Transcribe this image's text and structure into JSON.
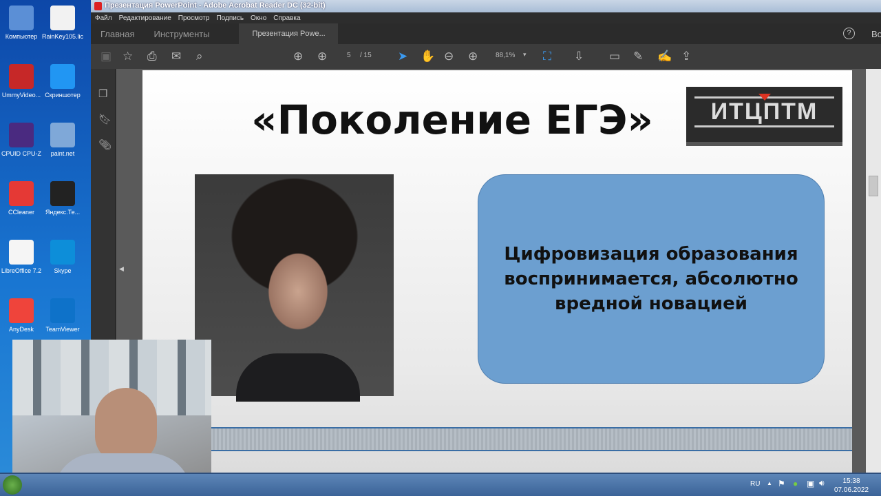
{
  "desktop": {
    "icons": [
      {
        "label": "Компьютер",
        "color": "#5b8fd6"
      },
      {
        "label": "RainKey105.lic",
        "color": "#f2f2f2"
      },
      {
        "label": "UmmyVideo...",
        "color": "#c62828"
      },
      {
        "label": "Скриншотер",
        "color": "#2196f3"
      },
      {
        "label": "CPUID CPU-Z",
        "color": "#4a2a80"
      },
      {
        "label": "paint.net",
        "color": "#7fa8d8"
      },
      {
        "label": "CCleaner",
        "color": "#e53935"
      },
      {
        "label": "Яндекс.Те...",
        "color": "#222222"
      },
      {
        "label": "LibreOffice 7.2",
        "color": "#f5f5f5"
      },
      {
        "label": "Skype",
        "color": "#0d8ed9"
      },
      {
        "label": "AnyDesk",
        "color": "#ef443b"
      },
      {
        "label": "TeamViewer",
        "color": "#0e72c9"
      }
    ]
  },
  "window": {
    "title": "Презентация PowerPoint - Adobe Acrobat Reader DC (32-bit)",
    "menu": [
      "Файл",
      "Редактирование",
      "Просмотр",
      "Подпись",
      "Окно",
      "Справка"
    ],
    "tabs": {
      "home": "Главная",
      "tools": "Инструменты",
      "document": "Презентация Powe...",
      "close": "×"
    },
    "help": "?",
    "sign_in": "Во"
  },
  "toolbar": {
    "page_current": "5",
    "page_total": "/ 15",
    "zoom": "88,1%"
  },
  "slide": {
    "title": "«Поколение ЕГЭ»",
    "logo": "ИТЦПТМ",
    "box_text": "Цифровизация образования воспринимается, абсолютно вредной новацией",
    "box_color": "#6c9fd0"
  },
  "taskbar": {
    "lang": "RU",
    "time": "15:38",
    "date": "07.06.2022"
  }
}
